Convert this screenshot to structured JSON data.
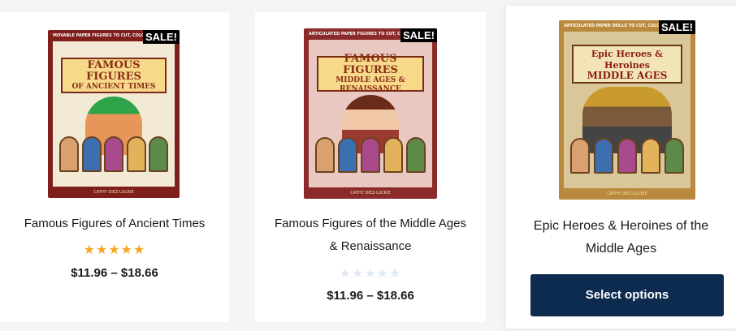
{
  "products": [
    {
      "cover": {
        "strip_text": "MOVABLE PAPER FIGURES TO CUT, COLOR, AND",
        "title_big": "FAMOUS FIGURES",
        "title_small": "OF ANCIENT TIMES",
        "author": "CATHY DIEZ-LUCKIE"
      },
      "sale_badge": "SALE!",
      "name": "Famous Figures of Ancient Times",
      "rating_stars": "★★★★★",
      "rating_value": 5,
      "price": "$11.96 – $18.66"
    },
    {
      "cover": {
        "strip_text": "ARTICULATED PAPER FIGURES TO CUT, COLOR,",
        "title_big": "FAMOUS FIGURES",
        "title_small": "MIDDLE AGES & RENAISSANCE",
        "author": "CATHY DIEZ-LUCKIE"
      },
      "sale_badge": "SALE!",
      "name_line1": "Famous Figures of the Middle Ages",
      "name_line2": "& Renaissance",
      "rating_stars": "★★★★★",
      "rating_value": 0,
      "price": "$11.96 – $18.66"
    },
    {
      "cover": {
        "strip_text": "ARTICULATED PAPER DOLLS TO CUT, COLOR, AN",
        "title_big": "Epic Heroes & Heroines",
        "title_small": "MIDDLE AGES",
        "author": "CATHY DIEZ-LUCKIE"
      },
      "sale_badge": "SALE!",
      "name_line1": "Epic Heroes & Heroines of the",
      "name_line2": "Middle Ages",
      "button_label": "Select options"
    }
  ],
  "colors": {
    "button_bg": "#0d2a4f",
    "star_filled": "#f5a623",
    "star_empty": "#dfe9f5"
  }
}
